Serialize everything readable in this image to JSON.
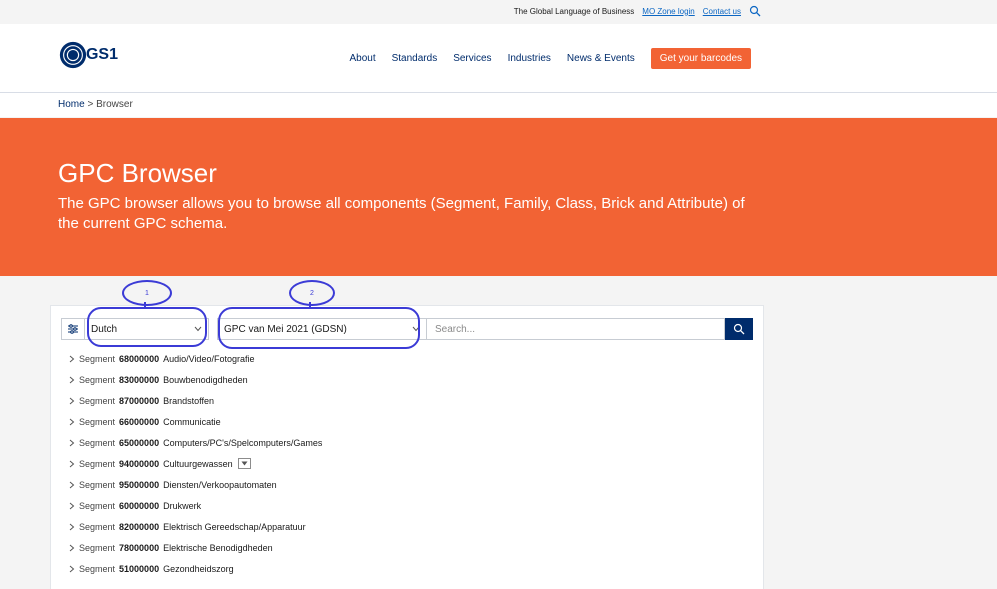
{
  "topbar": {
    "tagline": "The Global Language of Business",
    "links": [
      "MO Zone login",
      "Contact us"
    ]
  },
  "header": {
    "logo_text": "GS1",
    "nav": [
      "About",
      "Standards",
      "Services",
      "Industries",
      "News & Events"
    ],
    "cta": "Get your barcodes"
  },
  "breadcrumb": {
    "home": "Home",
    "separator": ">",
    "current": "Browser"
  },
  "hero": {
    "title": "GPC Browser",
    "description": "The GPC browser allows you to browse all components (Segment, Family, Class, Brick and Attribute) of the current GPC schema."
  },
  "controls": {
    "language": "Dutch",
    "version": "GPC van Mei 2021 (GDSN)",
    "search_placeholder": "Search..."
  },
  "annotations": {
    "bubble1": "1",
    "bubble2": "2"
  },
  "tree": [
    {
      "label": "Segment",
      "code": "68000000",
      "name": "Audio/Video/Fotografie"
    },
    {
      "label": "Segment",
      "code": "83000000",
      "name": "Bouwbenodigdheden"
    },
    {
      "label": "Segment",
      "code": "87000000",
      "name": "Brandstoffen"
    },
    {
      "label": "Segment",
      "code": "66000000",
      "name": "Communicatie"
    },
    {
      "label": "Segment",
      "code": "65000000",
      "name": "Computers/PC's/Spelcomputers/Games"
    },
    {
      "label": "Segment",
      "code": "94000000",
      "name": "Cultuurgewassen"
    },
    {
      "label": "Segment",
      "code": "95000000",
      "name": "Diensten/Verkoopautomaten"
    },
    {
      "label": "Segment",
      "code": "60000000",
      "name": "Drukwerk"
    },
    {
      "label": "Segment",
      "code": "82000000",
      "name": "Elektrisch Gereedschap/Apparatuur"
    },
    {
      "label": "Segment",
      "code": "78000000",
      "name": "Elektrische Benodigdheden"
    },
    {
      "label": "Segment",
      "code": "51000000",
      "name": "Gezondheidszorg"
    }
  ],
  "colors": {
    "brand_orange": "#f26334",
    "brand_navy": "#002c6c",
    "annotation": "#3b3bd6"
  }
}
